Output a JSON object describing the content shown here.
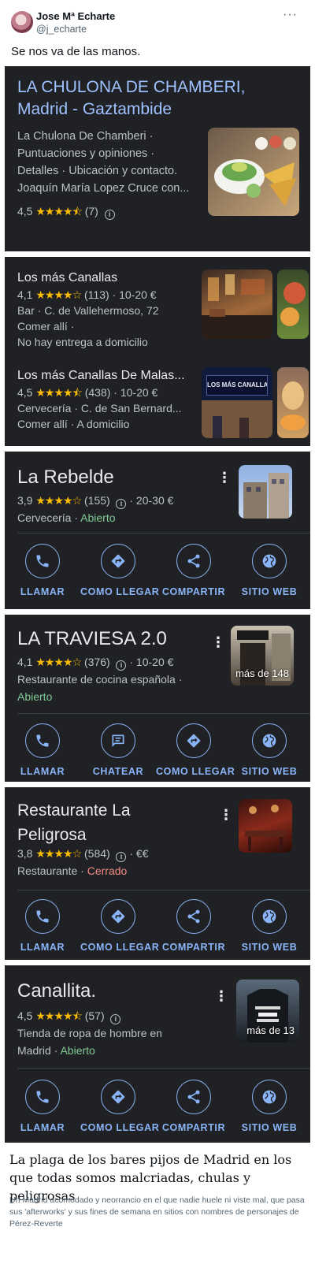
{
  "tweet": {
    "author_name": "Jose Mª Echarte",
    "author_handle": "@j_echarte",
    "text": "Se nos va de las manos."
  },
  "card1": {
    "title_line1": "LA CHULONA DE CHAMBERI,",
    "title_line2": "Madrid - Gaztambide",
    "desc_lines": [
      "La Chulona De Chamberi ·",
      "Puntuaciones y opiniones ·",
      "Detalles · Ubicación y contacto.",
      "Joaquín María Lopez Cruce con..."
    ],
    "rating": "4,5",
    "stars": "★★★★⯪",
    "reviews": "(7)"
  },
  "card2": {
    "items": [
      {
        "name": "Los más Canallas",
        "rating": "4,1",
        "stars": "★★★★☆",
        "reviews": "(113)",
        "price": "· 10-20 €",
        "line2": "Bar · C. de Vallehermoso, 72",
        "line3": "Comer allí ·",
        "line4": "No hay entrega a domicilio"
      },
      {
        "name": "Los más Canallas De Malas...",
        "rating": "4,5",
        "stars": "★★★★⯪",
        "reviews": "(438)",
        "price": "· 10-20 €",
        "line2": "Cervecería · C. de San Bernard...",
        "line3": "Comer allí · A domicilio",
        "sign_text": "LOS MÁS CANALLAS"
      }
    ]
  },
  "card3": {
    "name": "La Rebelde",
    "rating": "3,9",
    "stars": "★★★★☆",
    "reviews": "(155)",
    "price": "· 20-30 €",
    "type": "Cervecería · ",
    "status": "Abierto",
    "actions": [
      "LLAMAR",
      "COMO LLEGAR",
      "COMPARTIR",
      "SITIO WEB"
    ]
  },
  "card4": {
    "name": "LA TRAVIESA 2.0",
    "rating": "4,1",
    "stars": "★★★★☆",
    "reviews": "(376)",
    "price": "· 10-20 €",
    "type": "Restaurante de cocina española ·",
    "status": "Abierto",
    "photo_count": "más de 148",
    "actions": [
      "LLAMAR",
      "CHATEAR",
      "COMO LLEGAR",
      "SITIO WEB"
    ]
  },
  "card5": {
    "name_line1": "Restaurante La",
    "name_line2": "Peligrosa",
    "rating": "3,8",
    "stars": "★★★★☆",
    "reviews": "(584)",
    "price": "· €€",
    "type": "Restaurante · ",
    "status": "Cerrado",
    "actions": [
      "LLAMAR",
      "COMO LLEGAR",
      "COMPARTIR",
      "SITIO WEB"
    ]
  },
  "card6": {
    "name": "Canallita.",
    "rating": "4,5",
    "stars": "★★★★⯪",
    "reviews": "(57)",
    "type_line1": "Tienda de ropa de hombre en",
    "type_line2": "Madrid · ",
    "status": "Abierto",
    "photo_count": "más de 13",
    "actions": [
      "LLAMAR",
      "COMO LLEGAR",
      "COMPARTIR",
      "SITIO WEB"
    ]
  },
  "article": {
    "title": "La plaga de los bares pijos de Madrid en los que todas somos malcriadas, chulas y peligrosas",
    "description": "Un Madrid acomodado y neorrancio en el que nadie huele ni viste mal, que pasa sus 'afterworks' y sus fines de semana en sitios con nombres de personajes de Pérez-Reverte"
  },
  "colors": {
    "card_bg": "#202124",
    "link_blue": "#8ab4f8",
    "title_blue": "#9ec1ff",
    "star_yellow": "#fbbc04",
    "open_green": "#81c995",
    "closed_red": "#f28b82"
  }
}
